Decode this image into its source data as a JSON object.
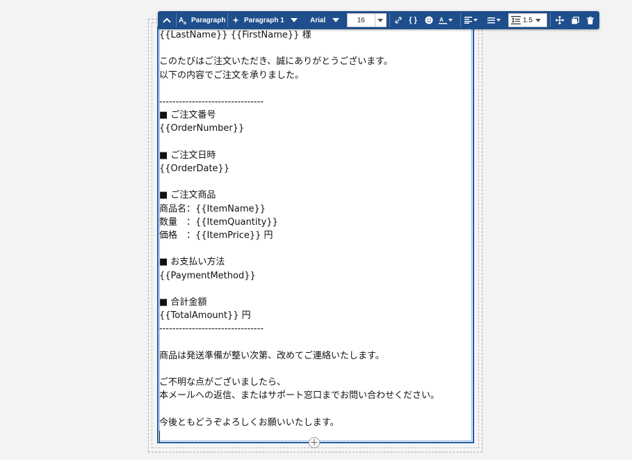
{
  "toolbar": {
    "block_type_label": "Paragraph",
    "style_label": "Paragraph 1",
    "font_label": "Arial",
    "font_size": "16",
    "line_height": "1.5",
    "icons": {
      "collapse": "chevron-up-icon",
      "block_type": "text-style-icon",
      "style": "sparkle-icon",
      "link": "link-icon",
      "variable": "curly-braces-icon",
      "emoji": "emoji-icon",
      "text_color": "text-color-icon",
      "align": "align-left-icon",
      "list": "list-icon",
      "line_height": "line-height-icon",
      "move": "move-icon",
      "duplicate": "duplicate-icon",
      "delete": "trash-icon"
    },
    "colors": {
      "toolbar_bg": "#1f4e8c",
      "selection_border": "#1e5da8"
    }
  },
  "document": {
    "text": "{{LastName}} {{FirstName}} 様\n\nこのたびはご注文いただき、誠にありがとうございます。\n以下の内容でご注文を承りました。\n\n--------------------------------\n■ ご注文番号\n{{OrderNumber}}\n\n■ ご注文日時\n{{OrderDate}}\n\n■ ご注文商品\n商品名：{{ItemName}}\n数量　：{{ItemQuantity}}\n価格　：{{ItemPrice}} 円\n\n■ お支払い方法\n{{PaymentMethod}}\n\n■ 合計金額\n{{TotalAmount}} 円\n--------------------------------\n\n商品は発送準備が整い次第、改めてご連絡いたします。\n\nご不明な点がございましたら、\n本メールへの返信、またはサポート窓口までお問い合わせください。\n\n今後ともどうぞよろしくお願いいたします。"
  },
  "add_block_icon": "plus-circle-icon"
}
